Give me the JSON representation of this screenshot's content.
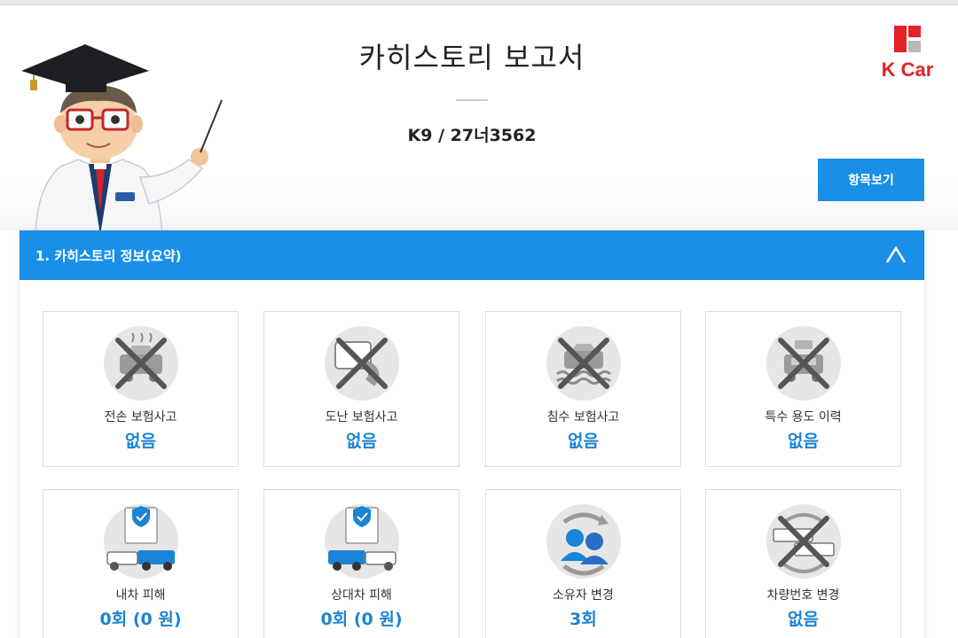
{
  "header": {
    "title": "카히스토리 보고서",
    "car_id": "K9 / 27너3562",
    "brand": "K Car",
    "items_button": "항목보기"
  },
  "section": {
    "title": "1. 카히스토리 정보(요약)",
    "toggle_icon": "chevron-up-icon"
  },
  "cards": [
    {
      "label": "전손 보험사고",
      "value": "없음",
      "icon": "total-loss-crossed-icon"
    },
    {
      "label": "도난 보험사고",
      "value": "없음",
      "icon": "theft-crossed-icon"
    },
    {
      "label": "침수 보험사고",
      "value": "없음",
      "icon": "flood-crossed-icon"
    },
    {
      "label": "특수 용도 이력",
      "value": "없음",
      "icon": "special-use-crossed-icon"
    },
    {
      "label": "내차 피해",
      "value": "0회 (0 원)",
      "icon": "my-car-damage-icon"
    },
    {
      "label": "상대차 피해",
      "value": "0회 (0 원)",
      "icon": "other-car-damage-icon"
    },
    {
      "label": "소유자 변경",
      "value": "3회",
      "icon": "owner-change-icon"
    },
    {
      "label": "차량번호 변경",
      "value": "없음",
      "icon": "plate-change-crossed-icon"
    }
  ],
  "colors": {
    "accent": "#1a8fe8",
    "value_text": "#1a84d6",
    "brand_red": "#e42228"
  }
}
